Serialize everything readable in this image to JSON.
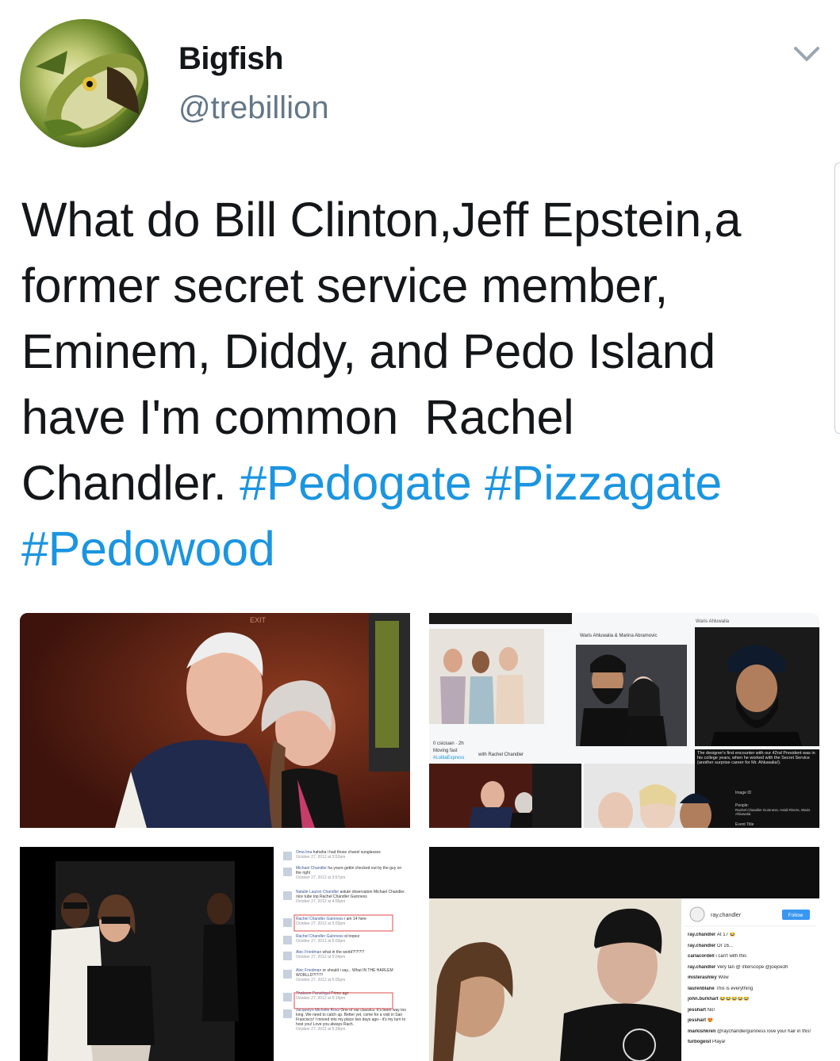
{
  "user": {
    "name": "Bigfish",
    "handle": "@trebillion",
    "avatar_icon": "bass-fish-avatar"
  },
  "menu_icon": "chevron-down-icon",
  "tweet": {
    "text_plain": "What do Bill Clinton,Jeff Epstein,a\nformer secret service member,\nEminem, Diddy, and Pedo Island\nhave I'm common  Rachel\nChandler. ",
    "hashtags": [
      "#Pedogate",
      "#Pizzagate",
      "#Pedowood"
    ]
  },
  "media": {
    "photo1": {
      "sign": "EXIT"
    },
    "photo2": {
      "header_right": "Waris Ahluwalia",
      "caption_mid": "Waris Ahluwalia & Marina Abramovic",
      "left_post_user": "0 csiciuan · 2h",
      "left_post_text": "Moving fast",
      "left_post_tag": "#LolitaExpress",
      "with_text": "with Rachel Chandler",
      "designer_caption": "The designer's first encounter with our 42nd President was in his college years, when he worked with the Secret Service (another surprise career for Mr. Ahluwalia!).",
      "image_id_label": "Image ID",
      "people_label": "People:",
      "people_value": "Rachel Chandler Guinness, Heidi Rivers, Waris Ahluwalia",
      "event_title_label": "Event Title"
    },
    "photo3": {
      "comments": [
        {
          "user": "Oma lma",
          "text": "hahaha i had those chanel sunglasses",
          "time": "October 27, 2012 at 3:52pm"
        },
        {
          "user": "Michael Chandler",
          "text": "ha youre gettin checked out by the guy on the right",
          "time": "October 27, 2012 at 3:57pm"
        },
        {
          "user": "Natalie Lauren Chandler",
          "text": "astute observation Michael Chandler. nice tube top Rachel Chandler Guinness",
          "time": "October 27, 2012 at 4:06pm"
        },
        {
          "user": "Rachel Chandler Guinness",
          "text": "i am 14 here",
          "time": "October 27, 2012 at 5:03pm"
        },
        {
          "user": "Rachel Chandler Guinness",
          "text": "st tropez",
          "time": "October 27, 2012 at 5:03pm"
        },
        {
          "user": "Alec Friedman",
          "text": "what in the world?!?!?!?",
          "time": "October 27, 2012 at 5:04pm"
        },
        {
          "user": "Alec Friedman",
          "text": "or should i say... What IN THE HARLEM WORLLD?!?!?!",
          "time": "October 27, 2012 at 5:05pm"
        },
        {
          "user": "Thakoon Panichgul",
          "text": "Prime age",
          "time": "October 27, 2012 at 5:14pm"
        },
        {
          "user": "Jacquelyn Michelle Ross",
          "text": "One of our classics. It's been way too long. We need to catch up. Better yet, come for a visit in San Francisco! I moved into my place two days ago-- it's my turn to host you! Love you always Rach.",
          "time": "October 27, 2012 at 5:39pm"
        }
      ]
    },
    "photo4": {
      "account": "ray.chandler",
      "follow_label": "Follow",
      "comments": [
        {
          "user": "ray.chandler",
          "text": "At 17 😂"
        },
        {
          "user": "ray.chandler",
          "text": "Or 16..."
        },
        {
          "user": "carlacordell",
          "text": "i can't with this"
        },
        {
          "user": "ray.chandler",
          "text": "Very tan @ interscope @joejoe3h"
        },
        {
          "user": "misterashley",
          "text": "Wow"
        },
        {
          "user": "laurenblane",
          "text": "This is everything"
        },
        {
          "user": "john.burkhart",
          "text": "😂😂😂😂😂"
        },
        {
          "user": "jesshart",
          "text": "No!"
        },
        {
          "user": "jesshart",
          "text": "😍"
        },
        {
          "user": "markishkreli",
          "text": "@raychandlerguinness love your hair in this!"
        },
        {
          "user": "turbogeist",
          "text": "Playa!"
        }
      ]
    }
  },
  "colors": {
    "text": "#14171a",
    "secondary": "#657786",
    "hashtag": "#1b95e0"
  }
}
